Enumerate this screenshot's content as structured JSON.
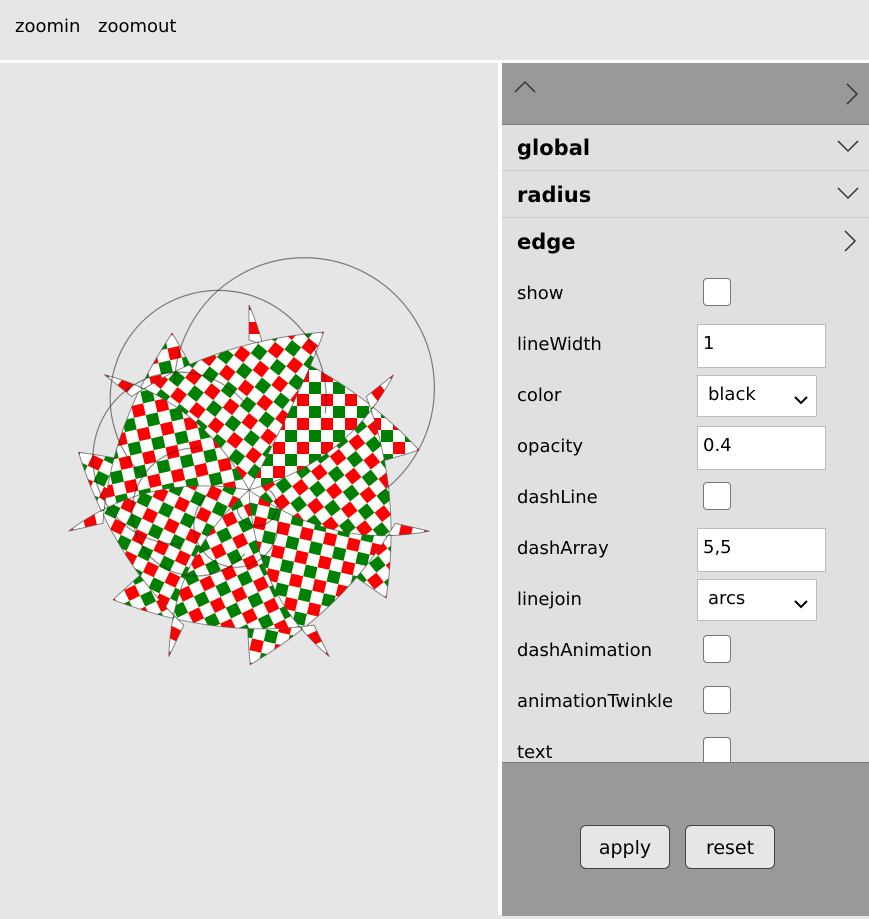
{
  "topbar": {
    "zoomin_label": "zoomin",
    "zoomout_label": "zoomout"
  },
  "colors": {
    "check_red": "#ff0000",
    "check_green": "#008000",
    "check_white": "#ffffff",
    "panel_gray": "#999999"
  },
  "panel": {
    "sections": [
      {
        "title": "global",
        "state": "collapsed"
      },
      {
        "title": "radius",
        "state": "collapsed"
      },
      {
        "title": "edge",
        "state": "expanded"
      }
    ],
    "edge": {
      "show_label": "show",
      "linewidth_label": "lineWidth",
      "linewidth_value": "1",
      "color_label": "color",
      "color_value": "black",
      "opacity_label": "opacity",
      "opacity_value": "0.4",
      "dashline_label": "dashLine",
      "dasharray_label": "dashArray",
      "dasharray_value": "5,5",
      "linejoin_label": "linejoin",
      "linejoin_value": "arcs",
      "dashanimation_label": "dashAnimation",
      "animationtwinkle_label": "animationTwinkle",
      "text_label": "text"
    },
    "footer": {
      "apply_label": "apply",
      "reset_label": "reset"
    }
  }
}
